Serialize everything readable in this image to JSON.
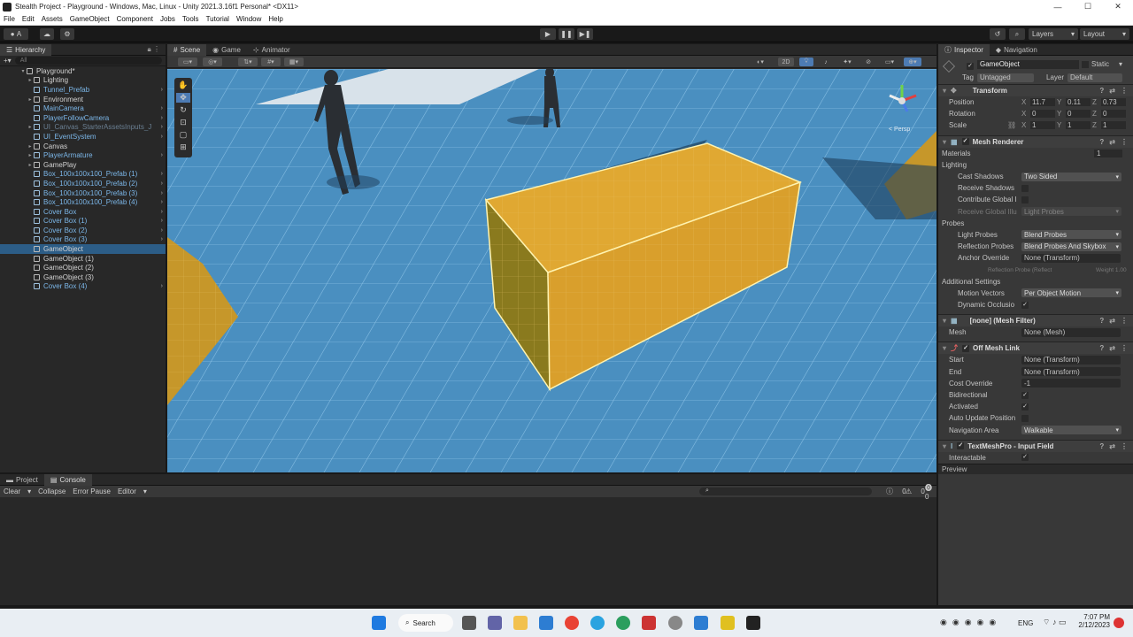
{
  "window": {
    "title": "Stealth Project - Playground - Windows, Mac, Linux - Unity 2021.3.16f1 Personal* <DX11>",
    "minimize": "—",
    "maximize": "☐",
    "close": "✕"
  },
  "menu": [
    "File",
    "Edit",
    "Assets",
    "GameObject",
    "Component",
    "Jobs",
    "Tools",
    "Tutorial",
    "Window",
    "Help"
  ],
  "toolbar": {
    "account": "A",
    "layers": "Layers",
    "layout": "Layout"
  },
  "hierarchy": {
    "tab": "Hierarchy",
    "search_placeholder": "All",
    "items": [
      {
        "label": "Playground*",
        "style": "white",
        "indent": 0
      },
      {
        "label": "Lighting",
        "style": "white",
        "indent": 1
      },
      {
        "label": "Tunnel_Prefab",
        "style": "blue",
        "indent": 1
      },
      {
        "label": "Environment",
        "style": "white",
        "indent": 1
      },
      {
        "label": "MainCamera",
        "style": "blue",
        "indent": 1
      },
      {
        "label": "PlayerFollowCamera",
        "style": "blue",
        "indent": 1
      },
      {
        "label": "UI_Canvas_StarterAssetsInputs_J",
        "style": "gray",
        "indent": 1
      },
      {
        "label": "UI_EventSystem",
        "style": "blue",
        "indent": 1
      },
      {
        "label": "Canvas",
        "style": "white",
        "indent": 1
      },
      {
        "label": "PlayerArmature",
        "style": "blue",
        "indent": 1
      },
      {
        "label": "GamePlay",
        "style": "white",
        "indent": 1
      },
      {
        "label": "Box_100x100x100_Prefab (1)",
        "style": "blue",
        "indent": 1
      },
      {
        "label": "Box_100x100x100_Prefab (2)",
        "style": "blue",
        "indent": 1
      },
      {
        "label": "Box_100x100x100_Prefab (3)",
        "style": "blue",
        "indent": 1
      },
      {
        "label": "Box_100x100x100_Prefab (4)",
        "style": "blue",
        "indent": 1
      },
      {
        "label": "Cover Box",
        "style": "blue",
        "indent": 1
      },
      {
        "label": "Cover Box (1)",
        "style": "blue",
        "indent": 1
      },
      {
        "label": "Cover Box (2)",
        "style": "blue",
        "indent": 1
      },
      {
        "label": "Cover Box (3)",
        "style": "blue",
        "indent": 1
      },
      {
        "label": "GameObject",
        "style": "white",
        "indent": 1
      },
      {
        "label": "GameObject (1)",
        "style": "white",
        "indent": 1
      },
      {
        "label": "GameObject (2)",
        "style": "white",
        "indent": 1
      },
      {
        "label": "GameObject (3)",
        "style": "white",
        "indent": 1
      },
      {
        "label": "Cover Box (4)",
        "style": "blue",
        "indent": 1
      }
    ]
  },
  "scene": {
    "tabs": [
      "Scene",
      "Game",
      "Animator"
    ],
    "mode_2d": "2D",
    "gizmo_label": "< Persp"
  },
  "inspector": {
    "tabs": [
      "Inspector",
      "Navigation"
    ],
    "object_name": "GameObject",
    "static_label": "Static",
    "tag_label": "Tag",
    "tag_value": "Untagged",
    "layer_label": "Layer",
    "layer_value": "Default",
    "transform": {
      "title": "Transform",
      "position_label": "Position",
      "position": [
        "11.7",
        "0.11",
        "0.73"
      ],
      "rotation_label": "Rotation",
      "rotation": [
        "0",
        "0",
        "0"
      ],
      "scale_label": "Scale",
      "scale": [
        "1",
        "1",
        "1"
      ]
    },
    "mesh_renderer": {
      "title": "Mesh Renderer",
      "materials_label": "Materials",
      "materials_count": "1",
      "lighting_label": "Lighting",
      "cast_shadows_label": "Cast Shadows",
      "cast_shadows": "Two Sided",
      "receive_shadows_label": "Receive Shadows",
      "contribute_gi_label": "Contribute Global I",
      "receive_gi_label": "Receive Global Illu",
      "receive_gi": "Light Probes",
      "probes_label": "Probes",
      "light_probes_label": "Light Probes",
      "light_probes": "Blend Probes",
      "reflection_probes_label": "Reflection Probes",
      "reflection_probes": "Blend Probes And Skybox",
      "anchor_override_label": "Anchor Override",
      "anchor_override": "None (Transform)",
      "probe_note": "Reflection Probe (Reflect",
      "probe_weight": "Weight 1.00",
      "additional_label": "Additional Settings",
      "motion_vectors_label": "Motion Vectors",
      "motion_vectors": "Per Object Motion",
      "dynamic_occlusion_label": "Dynamic Occlusio"
    },
    "mesh_filter": {
      "title": "[none] (Mesh Filter)",
      "mesh_label": "Mesh",
      "mesh_value": "None (Mesh)"
    },
    "off_mesh_link": {
      "title": "Off Mesh Link",
      "start_label": "Start",
      "start": "None (Transform)",
      "end_label": "End",
      "end": "None (Transform)",
      "cost_label": "Cost Override",
      "cost": "-1",
      "bidirectional_label": "Bidirectional",
      "activated_label": "Activated",
      "auto_update_label": "Auto Update Position",
      "nav_area_label": "Navigation Area",
      "nav_area": "Walkable"
    },
    "input_field": {
      "title": "TextMeshPro - Input Field",
      "interactable_label": "Interactable"
    },
    "preview_label": "Preview"
  },
  "bottom": {
    "tabs": [
      "Project",
      "Console"
    ],
    "console_buttons": [
      "Clear",
      "Collapse",
      "Error Pause",
      "Editor"
    ],
    "counts": [
      "0",
      "0",
      "0"
    ]
  },
  "taskbar": {
    "search": "Search",
    "lang": "ENG",
    "time": "7:07 PM",
    "date": "2/12/2023"
  },
  "colors": {
    "accent": "#2c5d87",
    "box": "#d9a12b",
    "floor": "#4a8fc0",
    "prefab_blue": "#7bb6e8"
  }
}
